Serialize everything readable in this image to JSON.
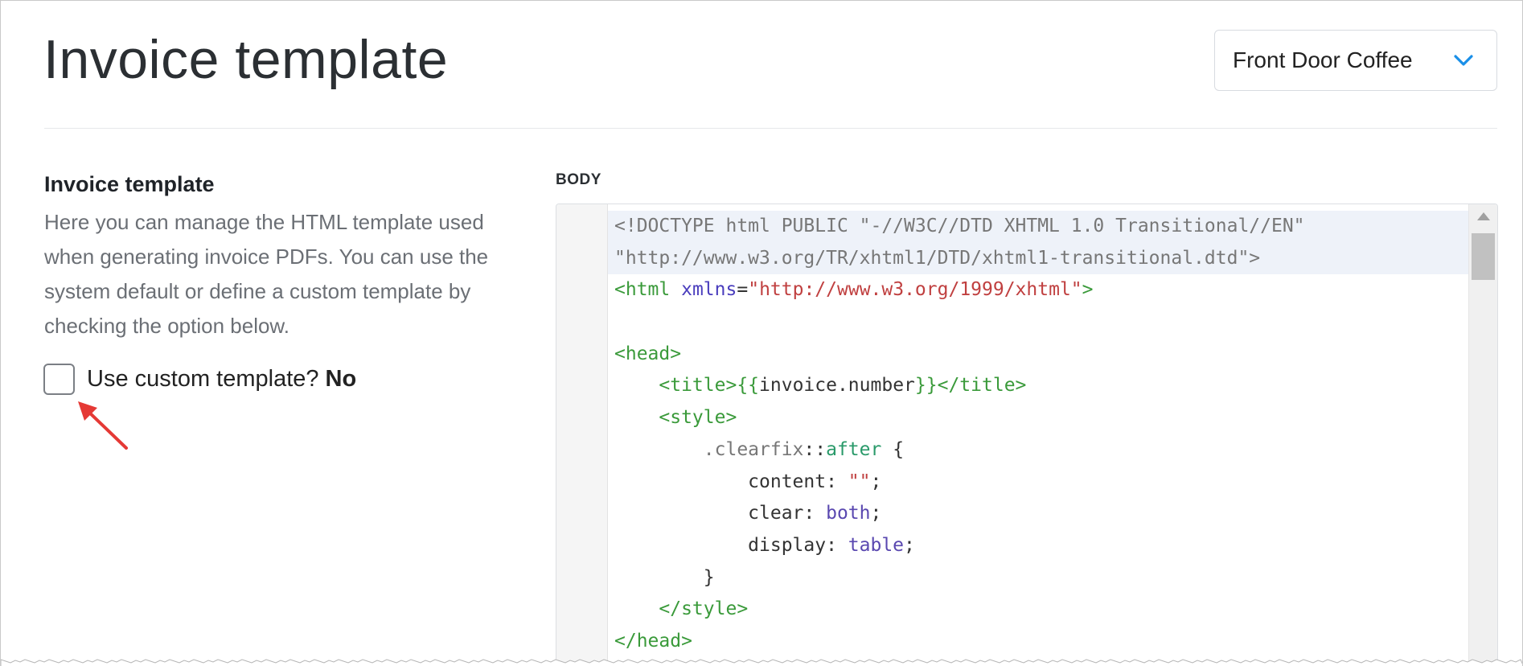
{
  "header": {
    "title": "Invoice template",
    "entity_select": {
      "value": "Front Door Coffee",
      "icon": "chevron-down-icon",
      "icon_color": "#1a8fe8"
    }
  },
  "section": {
    "title": "Invoice template",
    "description": "Here you can manage the HTML template used when generating invoice PDFs. You can use the system default or define a custom template by checking the option below.",
    "custom_template": {
      "label": "Use custom template?",
      "state": "No",
      "checked": false
    }
  },
  "annotation": {
    "icon": "red-arrow-icon",
    "color": "#e53935"
  },
  "editor": {
    "label": "BODY",
    "lines": [
      [
        {
          "t": "<!DOCTYPE html PUBLIC \"-//W3C//DTD XHTML 1.0 Transitional//EN\"",
          "c": "meta"
        }
      ],
      [
        {
          "t": "\"http://www.w3.org/TR/xhtml1/DTD/xhtml1-transitional.dtd\">",
          "c": "meta"
        }
      ],
      [
        {
          "t": "<html",
          "c": "tag"
        },
        {
          "t": " ",
          "c": "plain"
        },
        {
          "t": "xmlns",
          "c": "attr"
        },
        {
          "t": "=",
          "c": "plain"
        },
        {
          "t": "\"http://www.w3.org/1999/xhtml\"",
          "c": "str"
        },
        {
          "t": ">",
          "c": "tag"
        }
      ],
      [],
      [
        {
          "t": "<head>",
          "c": "tag"
        }
      ],
      [
        {
          "t": "    ",
          "c": "plain"
        },
        {
          "t": "<title>",
          "c": "tag"
        },
        {
          "t": "{{",
          "c": "tag"
        },
        {
          "t": "invoice.number",
          "c": "plain"
        },
        {
          "t": "}}",
          "c": "tag"
        },
        {
          "t": "</title>",
          "c": "tag"
        }
      ],
      [
        {
          "t": "    ",
          "c": "plain"
        },
        {
          "t": "<style>",
          "c": "tag"
        }
      ],
      [
        {
          "t": "        ",
          "c": "plain"
        },
        {
          "t": ".clearfix",
          "c": "meta"
        },
        {
          "t": "::",
          "c": "plain"
        },
        {
          "t": "after",
          "c": "kw"
        },
        {
          "t": " {",
          "c": "plain"
        }
      ],
      [
        {
          "t": "            content: ",
          "c": "plain"
        },
        {
          "t": "\"\"",
          "c": "str"
        },
        {
          "t": ";",
          "c": "plain"
        }
      ],
      [
        {
          "t": "            clear: ",
          "c": "plain"
        },
        {
          "t": "both",
          "c": "val"
        },
        {
          "t": ";",
          "c": "plain"
        }
      ],
      [
        {
          "t": "            display: ",
          "c": "plain"
        },
        {
          "t": "table",
          "c": "val"
        },
        {
          "t": ";",
          "c": "plain"
        }
      ],
      [
        {
          "t": "        }",
          "c": "plain"
        }
      ],
      [
        {
          "t": "    ",
          "c": "plain"
        },
        {
          "t": "</style>",
          "c": "tag"
        }
      ],
      [
        {
          "t": "</head>",
          "c": "tag"
        }
      ]
    ],
    "highlighted_lines": [
      0,
      1
    ]
  }
}
